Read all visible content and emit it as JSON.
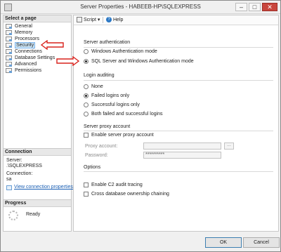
{
  "window": {
    "title": "Server Properties - HABEEB-HP\\SQLEXPRESS"
  },
  "title_buttons": {
    "minimize": "–",
    "maximize": "□",
    "close": "✕"
  },
  "left": {
    "header": "Select a page",
    "pages": [
      {
        "label": "General",
        "selected": false
      },
      {
        "label": "Memory",
        "selected": false
      },
      {
        "label": "Processors",
        "selected": false
      },
      {
        "label": "Security",
        "selected": true
      },
      {
        "label": "Connections",
        "selected": false
      },
      {
        "label": "Database Settings",
        "selected": false
      },
      {
        "label": "Advanced",
        "selected": false
      },
      {
        "label": "Permissions",
        "selected": false
      }
    ],
    "connection": {
      "header": "Connection",
      "server_label": "Server:",
      "server_value": ".\\SQLEXPRESS",
      "connection_label": "Connection:",
      "connection_value": "sa",
      "link": "View connection properties"
    },
    "progress": {
      "header": "Progress",
      "status": "Ready"
    }
  },
  "toolbar": {
    "script": "Script",
    "script_arrow": "▾",
    "help": "Help",
    "help_glyph": "?"
  },
  "auth": {
    "header": "Server authentication",
    "options": [
      {
        "label": "Windows Authentication mode",
        "checked": false
      },
      {
        "label": "SQL Server and Windows Authentication mode",
        "checked": true
      }
    ]
  },
  "auditing": {
    "header": "Login auditing",
    "options": [
      {
        "label": "None",
        "checked": false
      },
      {
        "label": "Failed logins only",
        "checked": true
      },
      {
        "label": "Successful logins only",
        "checked": false
      },
      {
        "label": "Both failed and successful logins",
        "checked": false
      }
    ]
  },
  "proxy": {
    "header": "Server proxy account",
    "enable_label": "Enable server proxy account",
    "account_label": "Proxy account:",
    "account_value": "",
    "password_label": "Password:",
    "password_value": "**********",
    "browse": "..."
  },
  "options": {
    "header": "Options",
    "c2_label": "Enable C2 audit tracing",
    "chaining_label": "Cross database ownership chaining"
  },
  "buttons": {
    "ok": "OK",
    "cancel": "Cancel"
  },
  "colors": {
    "annotation_arrow": "#d9221c",
    "selection": "#cde6f7",
    "ok_border": "#3c7fb1"
  }
}
